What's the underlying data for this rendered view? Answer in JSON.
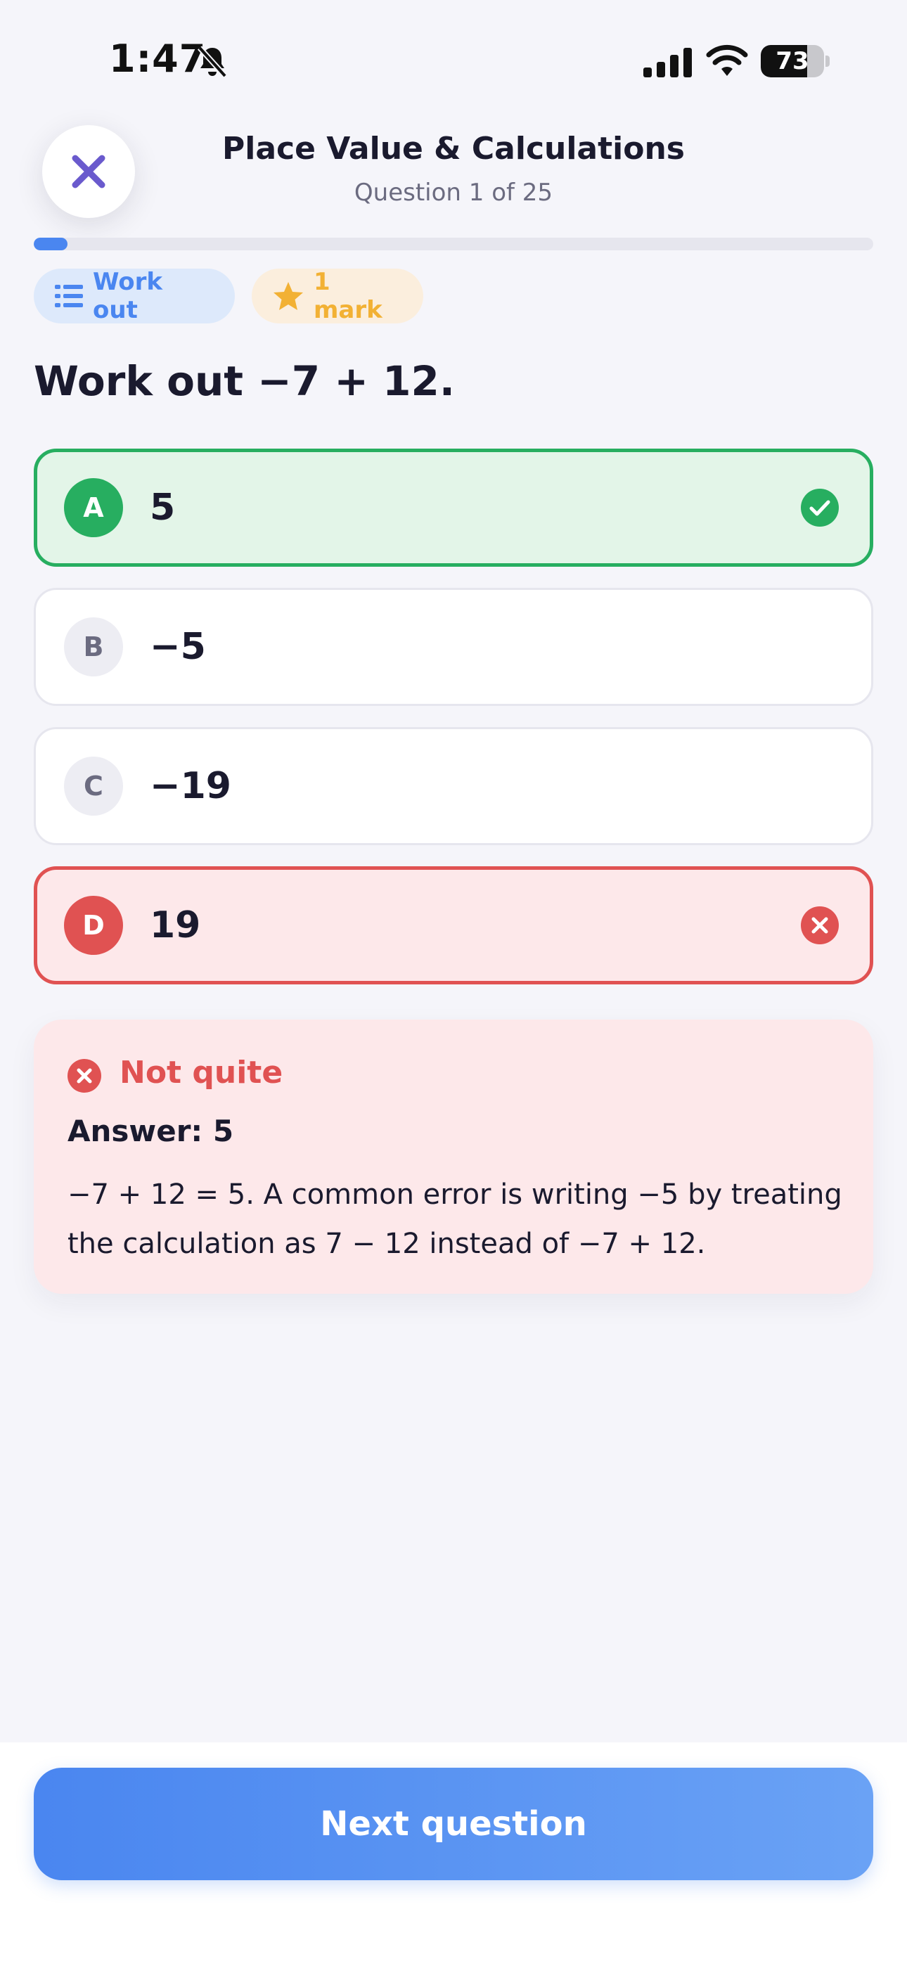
{
  "status_bar": {
    "time": "1:47",
    "battery_level": "73",
    "battery_fraction": 0.73
  },
  "header": {
    "title": "Place Value & Calculations",
    "counter": "Question 1 of 25",
    "progress_fraction": 0.04
  },
  "tags": [
    {
      "label": "Work out",
      "icon": "list-icon",
      "color": "#4a86f0"
    },
    {
      "label": "1 mark",
      "icon": "star-icon",
      "color": "#f2b134"
    }
  ],
  "question": {
    "text": "Work out −7 + 12."
  },
  "options": [
    {
      "letter": "A",
      "value": "5",
      "state": "correct"
    },
    {
      "letter": "B",
      "value": "−5",
      "state": "neutral"
    },
    {
      "letter": "C",
      "value": "−19",
      "state": "neutral"
    },
    {
      "letter": "D",
      "value": "19",
      "state": "wrong"
    }
  ],
  "feedback": {
    "title": "Not quite",
    "answer": "Answer: 5",
    "explanation": "−7 + 12 = 5. A common error is writing −5 by treating the calculation as 7 − 12 instead of −7 + 12."
  },
  "footer": {
    "next_label": "Next question"
  },
  "colors": {
    "correct": "#27ae60",
    "wrong": "#e05252",
    "accent": "#4a86f0",
    "close_icon": "#6a5acd"
  }
}
